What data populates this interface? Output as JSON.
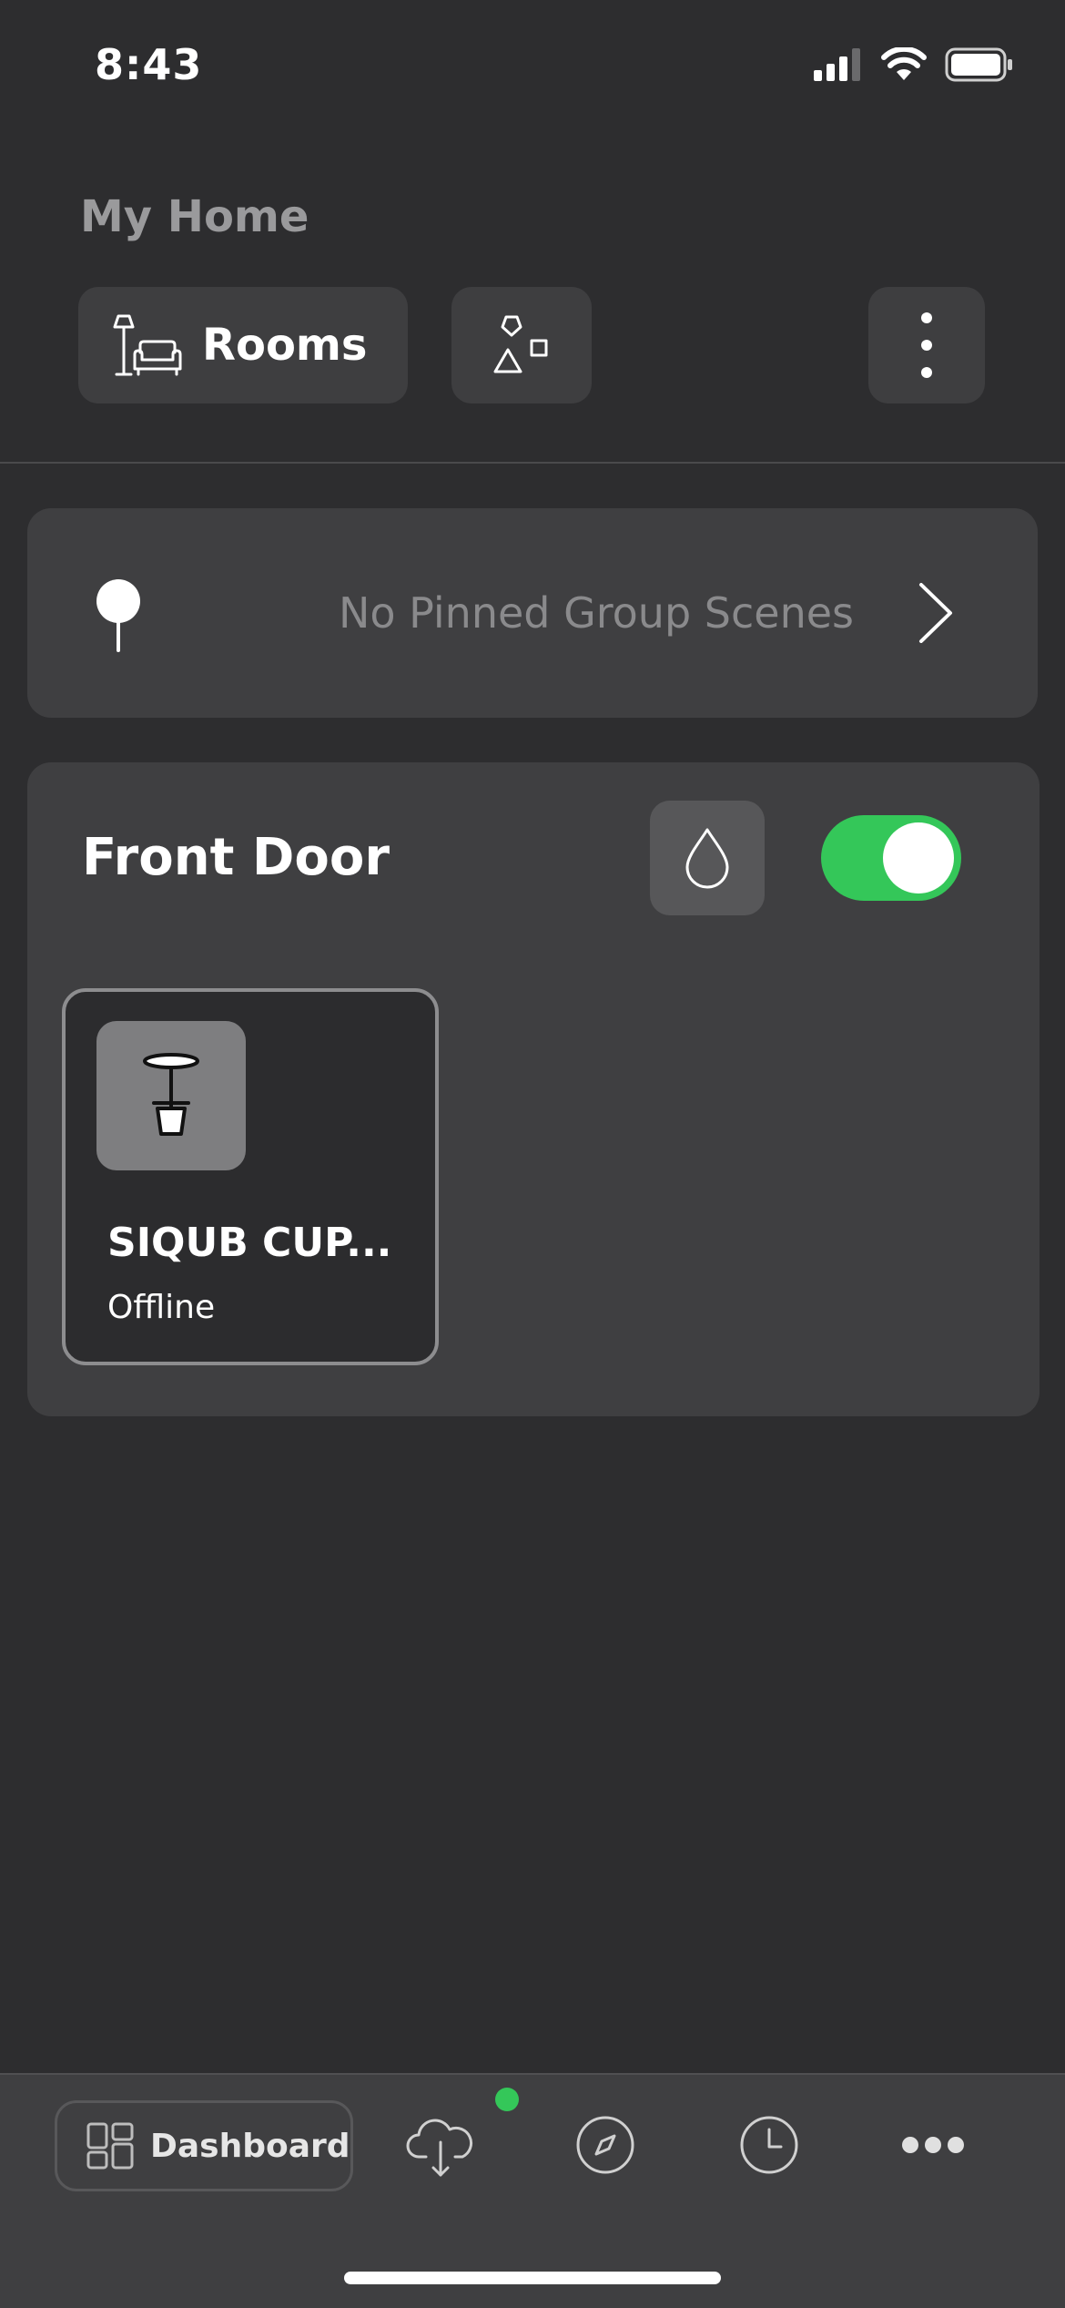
{
  "status_bar": {
    "time": "8:43"
  },
  "header": {
    "title": "My Home",
    "rooms_label": "Rooms"
  },
  "pinned": {
    "text": "No Pinned Group Scenes"
  },
  "group": {
    "title": "Front Door",
    "toggle_on": true,
    "device": {
      "name": "SIQUB CUP...",
      "status": "Offline"
    }
  },
  "nav": {
    "dashboard_label": "Dashboard"
  },
  "colors": {
    "accent": "#34c759",
    "background": "#2d2d2f",
    "card": "#3f3f41"
  },
  "icons": [
    "signal-icon",
    "wifi-icon",
    "battery-icon",
    "lamp-sofa-icon",
    "shapes-icon",
    "kebab-menu-icon",
    "pin-icon",
    "chevron-right-icon",
    "droplet-icon",
    "table-lamp-icon",
    "dashboard-grid-icon",
    "cloud-download-icon",
    "compass-icon",
    "clock-icon",
    "more-dots-icon"
  ]
}
